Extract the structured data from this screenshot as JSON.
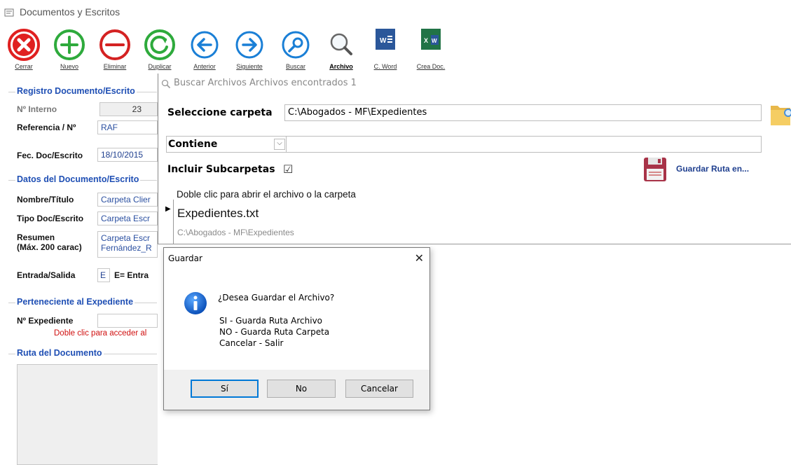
{
  "window": {
    "title": "Documentos y Escritos"
  },
  "toolbar": {
    "buttons": [
      {
        "label": "Cerrar",
        "icon": "close-circle-icon",
        "color": "#e02020"
      },
      {
        "label": "Nuevo",
        "icon": "plus-circle-icon",
        "color": "#2eaa3c"
      },
      {
        "label": "Eliminar",
        "icon": "minus-circle-icon",
        "color": "#d42222"
      },
      {
        "label": "Duplicar",
        "icon": "refresh-circle-icon",
        "color": "#2eaa3c"
      },
      {
        "label": "Anterior",
        "icon": "arrow-left-circle-icon",
        "color": "#1a7fd6"
      },
      {
        "label": "Siguiente",
        "icon": "arrow-right-circle-icon",
        "color": "#1a7fd6"
      },
      {
        "label": "Buscar",
        "icon": "search-circle-icon",
        "color": "#1a7fd6"
      },
      {
        "label": "Archivo",
        "icon": "magnifier-icon",
        "color": "#555555"
      },
      {
        "label": "C. Word",
        "icon": "word-icon",
        "color": "#2b579a"
      },
      {
        "label": "Crea Doc.",
        "icon": "excel-word-icon",
        "color": "#217346"
      }
    ]
  },
  "registro": {
    "legend": "Registro Documento/Escrito",
    "interno_label": "Nº Interno",
    "interno_value": "23",
    "referencia_label": "Referencia / Nº",
    "referencia_value": "RAF",
    "fecha_label": "Fec. Doc/Escrito",
    "fecha_value": "18/10/2015"
  },
  "datos": {
    "legend": "Datos del Documento/Escrito",
    "nombre_label": "Nombre/Título",
    "nombre_value": "Carpeta Clier",
    "tipo_label": "Tipo Doc/Escrito",
    "tipo_value": "Carpeta Escr",
    "resumen_label": "Resumen",
    "resumen_sublabel": "(Máx. 200 carac)",
    "resumen_line1": "Carpeta Escr",
    "resumen_line2": "Fernández_R",
    "entrada_label": "Entrada/Salida",
    "entrada_value": "E",
    "entrada_hint": "E= Entra"
  },
  "expediente": {
    "legend": "Perteneciente al Expediente",
    "label": "Nº Expediente",
    "hint": "Doble clic para acceder al"
  },
  "ruta": {
    "legend": "Ruta del Documento"
  },
  "search_panel": {
    "header": "Buscar Archivos   Archivos encontrados  1",
    "folder_label": "Seleccione carpeta",
    "folder_value": "C:\\Abogados - MF\\Expedientes",
    "contains_label": "Contiene",
    "contains_value": "",
    "subfolders_label": "Incluir Subcarpetas",
    "subfolders_checked": "☑",
    "save_path_label": "Guardar Ruta en...",
    "hint": "Doble clic para abrir el archivo o la carpeta",
    "result_file": "Expedientes.txt",
    "result_path": "C:\\Abogados - MF\\Expedientes"
  },
  "dialog": {
    "title": "Guardar",
    "close": "✕",
    "question": "¿Desea Guardar el Archivo?",
    "line1": "SI  - Guarda Ruta Archivo",
    "line2": "NO - Guarda Ruta Carpeta",
    "line3": "Cancelar - Salir",
    "btn_yes": "Sí",
    "btn_no": "No",
    "btn_cancel": "Cancelar"
  }
}
